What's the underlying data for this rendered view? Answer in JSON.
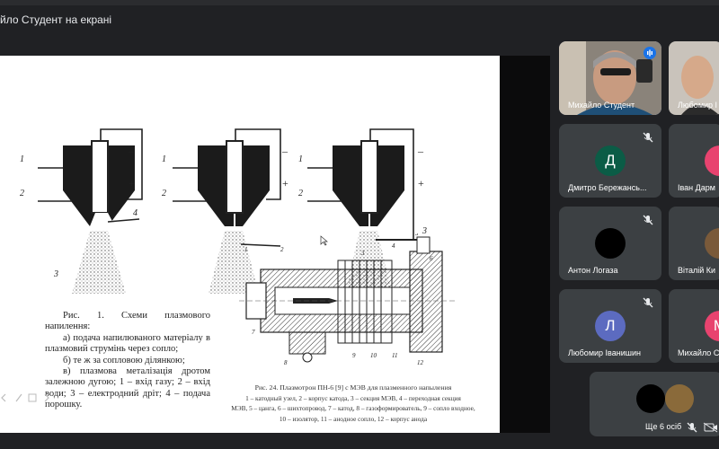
{
  "window": {
    "title": "йло Студент на екрані"
  },
  "slide": {
    "figure1_caption": [
      "Рис. 1. Схеми плазмового напилення:",
      "а) подача напилюваного матеріалу в плазмовий струмінь через сопло;",
      "б) те ж за сопловою ділянкою;",
      "в) плазмова металізація дротом залежною дугою; 1 – вхід газу; 2 – вхід води; 3 – електродний дріт; 4 – подача порошку."
    ],
    "figure24_caption_head": "Рис. 24. Плазмотрон ПН-6 [9] с МЭВ для плазменного напыления",
    "figure24_caption_lines": [
      "1 – катодный узел, 2 – корпус катода, 3 – секция МЭВ, 4 – переходная секция",
      "МЭВ, 5 – цанга, 6 – шихтопровод, 7 – катод, 8 – газоформирователь, 9 – сопло входное,",
      "10 – изолятор, 11 – анодное сопло, 12 – корпус анода"
    ],
    "diagram_labels": {
      "one": "1",
      "two": "2",
      "three": "3",
      "four": "4",
      "minus": "–",
      "plus": "+"
    },
    "plasmatron_labels": [
      "1",
      "2",
      "3",
      "4",
      "5",
      "6",
      "7",
      "8",
      "9",
      "10",
      "11",
      "12"
    ]
  },
  "participants": [
    {
      "name": "Михайло Студент",
      "initial": "",
      "color": "#5f6368",
      "muted": false,
      "speaking": true,
      "video": true
    },
    {
      "name": "Любомир І",
      "initial": "",
      "color": "#5f6368",
      "muted": false,
      "speaking": false,
      "video": true
    },
    {
      "name": "Дмитро Бережансь...",
      "initial": "Д",
      "color": "#0b5c46",
      "muted": true,
      "speaking": false,
      "video": false
    },
    {
      "name": "Іван Дарм",
      "initial": "",
      "color": "#e8436f",
      "muted": true,
      "speaking": false,
      "video": false
    },
    {
      "name": "Антон Логаза",
      "initial": "",
      "color": "#000000",
      "muted": true,
      "speaking": false,
      "video": false
    },
    {
      "name": "Віталій Ки",
      "initial": "",
      "color": "#7a5a3a",
      "muted": true,
      "speaking": false,
      "video": false
    },
    {
      "name": "Любомир Іванишин",
      "initial": "Л",
      "color": "#5c6bc0",
      "muted": true,
      "speaking": false,
      "video": false
    },
    {
      "name": "Михайло С",
      "initial": "М",
      "color": "#e8436f",
      "muted": true,
      "speaking": false,
      "video": false
    }
  ],
  "others": {
    "label": "Ще 6 осіб"
  }
}
